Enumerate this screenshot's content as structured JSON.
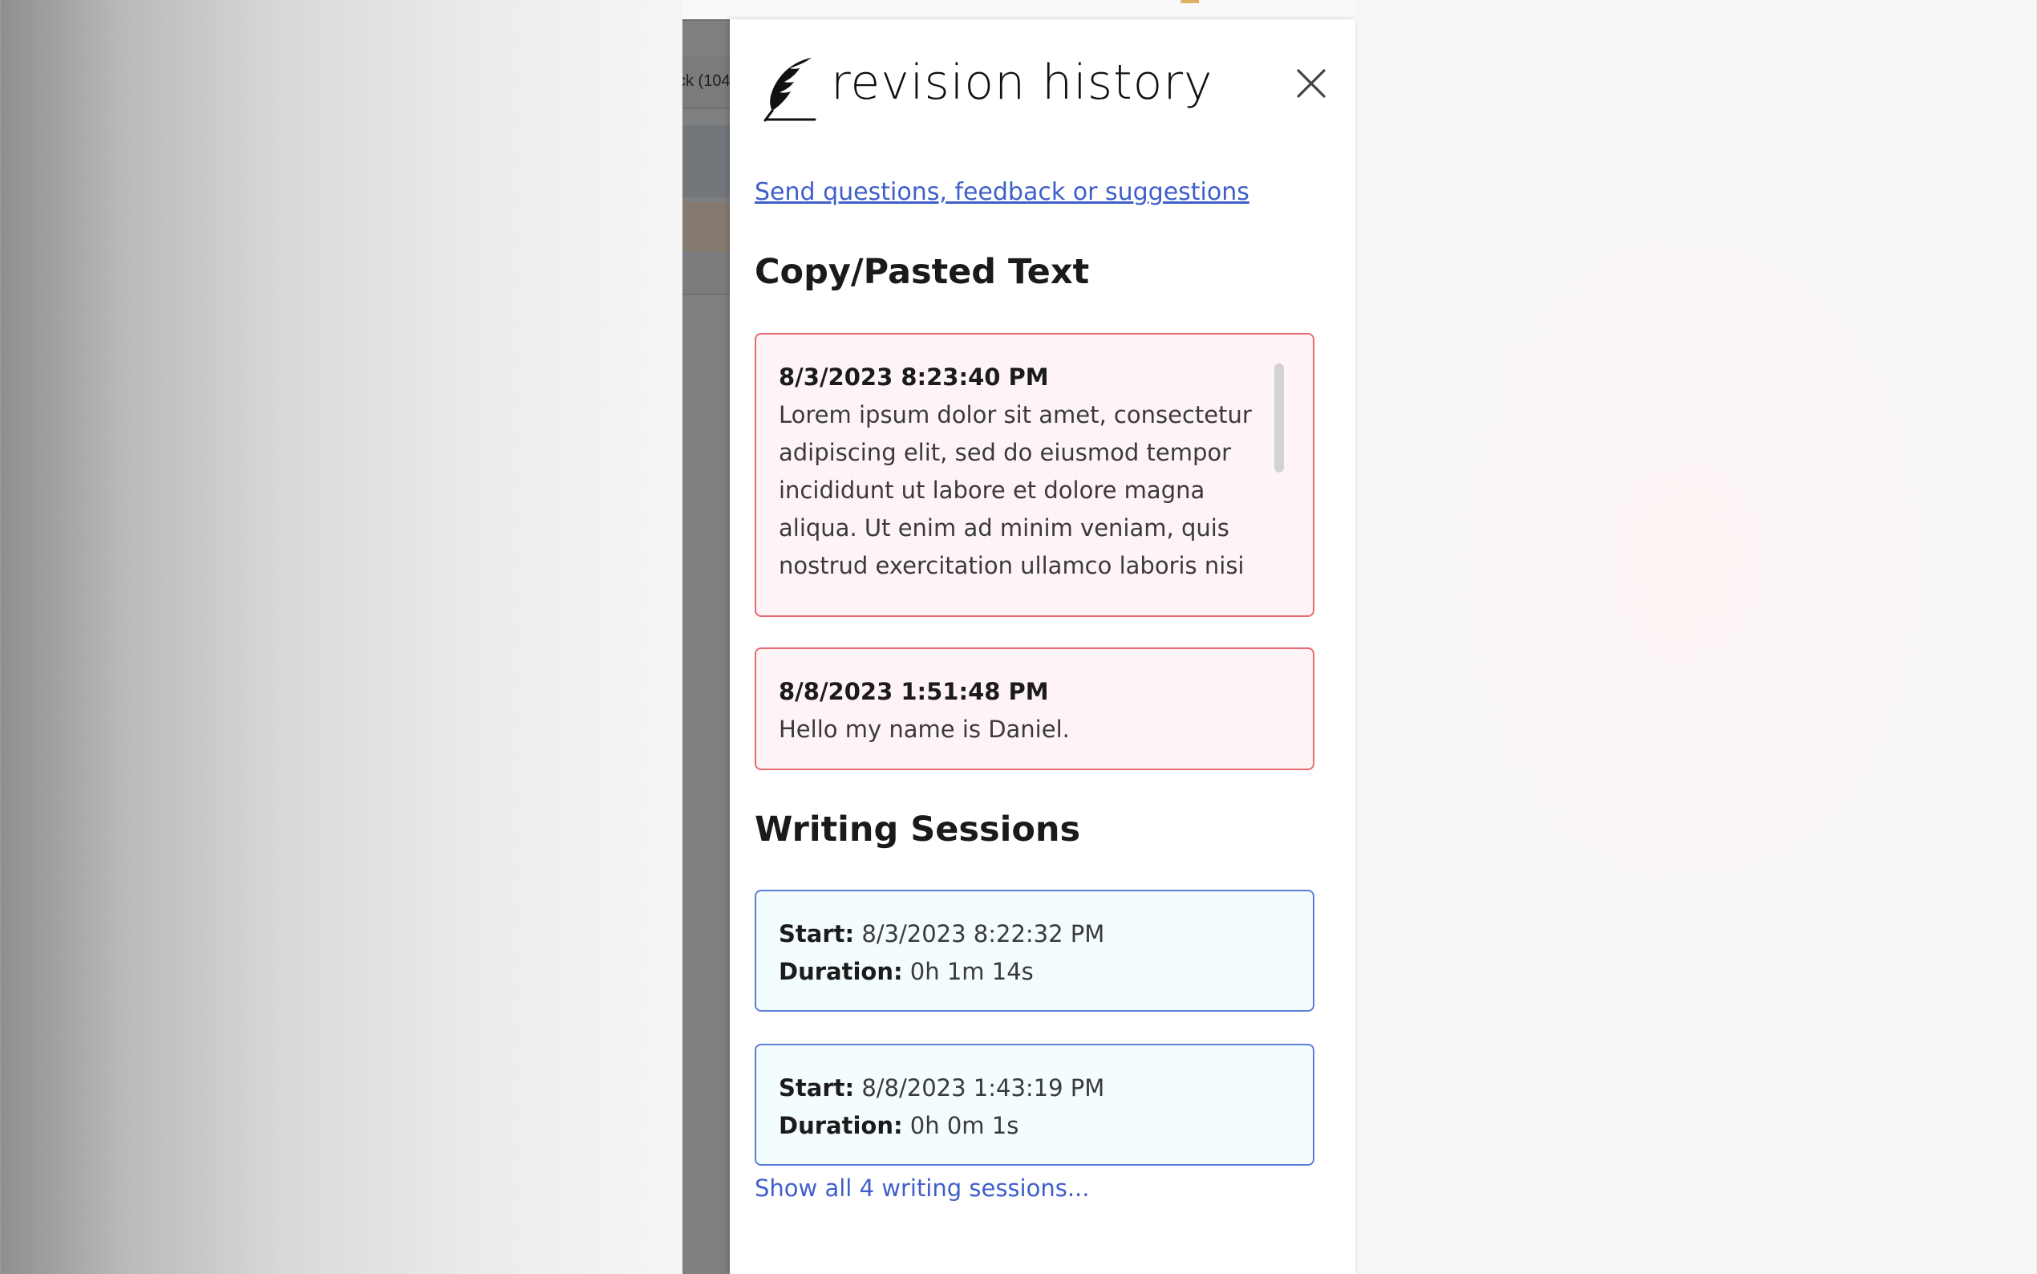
{
  "background": {
    "underlay_tab_text": "ck (104"
  },
  "panel": {
    "brand_title": "revision history",
    "close_icon": "close-icon",
    "feedback_link": "Send questions, feedback or suggestions",
    "copy_paste": {
      "title": "Copy/Pasted Text",
      "items": [
        {
          "timestamp": "8/3/2023 8:23:40 PM",
          "text": "Lorem ipsum dolor sit amet, consectetur adipiscing elit, sed do eiusmod tempor incididunt ut labore et dolore magna aliqua. Ut enim ad minim veniam, quis nostrud exercitation ullamco laboris nisi ut aliquip"
        },
        {
          "timestamp": "8/8/2023 1:51:48 PM",
          "text": "Hello my name is Daniel."
        }
      ]
    },
    "writing_sessions": {
      "title": "Writing Sessions",
      "start_label": "Start:",
      "duration_label": "Duration:",
      "items": [
        {
          "start": "8/3/2023 8:22:32 PM",
          "duration": "0h 1m 14s"
        },
        {
          "start": "8/8/2023 1:43:19 PM",
          "duration": "0h 0m 1s"
        }
      ],
      "show_all": "Show all 4 writing sessions..."
    }
  },
  "colors": {
    "link": "#3f5fc9",
    "paste_border": "#e76a73",
    "paste_bg": "#fff4f5",
    "session_border": "#5d7ed6",
    "session_bg": "#f3fcfe"
  }
}
